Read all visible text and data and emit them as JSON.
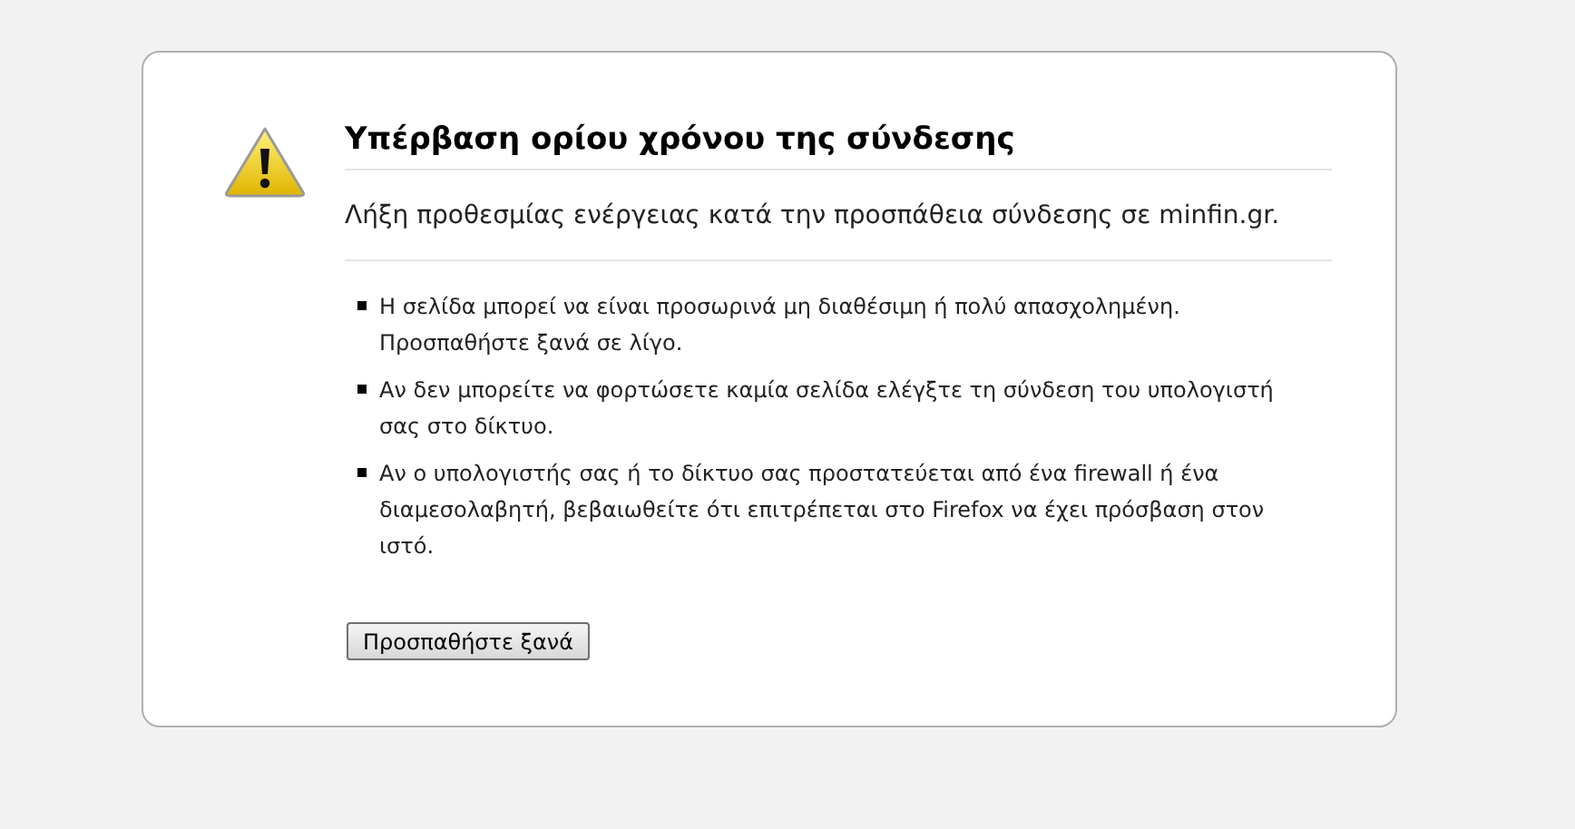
{
  "title": "Υπέρβαση ορίου χρόνου της σύνδεσης",
  "description": "Λήξη προθεσμίας ενέργειας κατά την προσπάθεια σύνδεσης σε minfin.gr.",
  "suggestions": [
    "Η σελίδα μπορεί να είναι προσωρινά μη διαθέσιμη ή πολύ απασχολημένη. Προσπαθήστε ξανά σε λίγο.",
    "Αν δεν μπορείτε να φορτώσετε καμία σελίδα ελέγξτε τη σύνδεση του υπολογιστή σας στο δίκτυο.",
    "Αν ο υπολογιστής σας ή το δίκτυο σας προστατεύεται από ένα firewall ή ένα διαμεσολαβητή, βεβαιωθείτε ότι επιτρέπεται στο Firefox να έχει πρόσβαση στον ιστό."
  ],
  "button": "Προσπαθήστε ξανά"
}
